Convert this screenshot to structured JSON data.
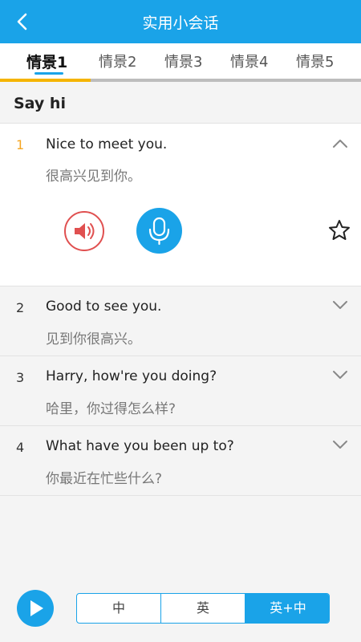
{
  "header": {
    "title": "实用小会话",
    "back_icon": "chevron-left-icon"
  },
  "tabs": [
    {
      "label": "情景1",
      "active": true
    },
    {
      "label": "情景2",
      "active": false
    },
    {
      "label": "情景3",
      "active": false
    },
    {
      "label": "情景4",
      "active": false
    },
    {
      "label": "情景5",
      "active": false
    }
  ],
  "tab_progress": 0.25,
  "section": {
    "title": "Say hi"
  },
  "items": [
    {
      "num": "1",
      "en": "Nice to meet you.",
      "zh": "很高兴见到你。",
      "expanded": true
    },
    {
      "num": "2",
      "en": "Good to see you.",
      "zh": "见到你很高兴。",
      "expanded": false
    },
    {
      "num": "3",
      "en": "Harry, how're you doing?",
      "zh": "哈里，你过得怎么样?",
      "expanded": false
    },
    {
      "num": "4",
      "en": "What have you been up to?",
      "zh": "你最近在忙些什么?",
      "expanded": false
    }
  ],
  "actions": {
    "speaker_icon": "speaker-icon",
    "mic_icon": "microphone-icon",
    "star_icon": "star-icon"
  },
  "bottom": {
    "play_icon": "play-icon",
    "segments": [
      "中",
      "英",
      "英+中"
    ],
    "selected": "英+中"
  },
  "colors": {
    "primary": "#1aa3e8",
    "accent": "#f5a623",
    "speaker": "#e05050"
  }
}
